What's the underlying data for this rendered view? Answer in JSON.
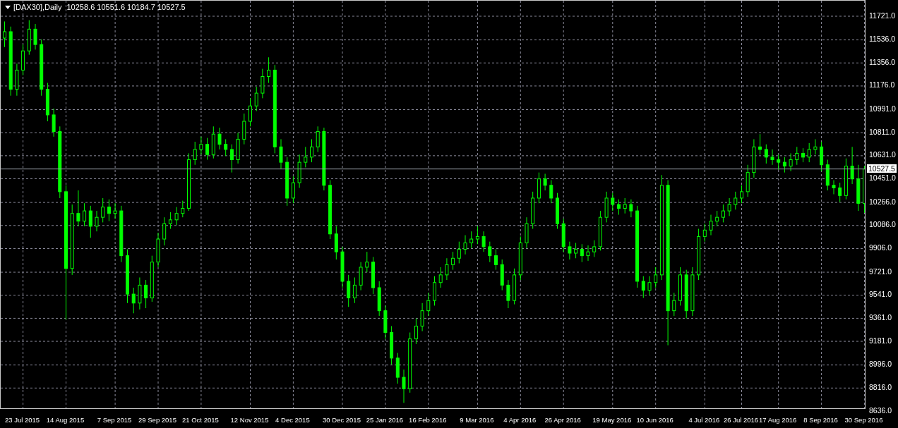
{
  "header": {
    "symbol": "[DAX30],Daily",
    "ohlc": "10258.6 10551.6 10184.7 10527.5"
  },
  "current_price": "10527.5",
  "chart_data": {
    "type": "candlestick",
    "categories": [
      null,
      null,
      null,
      "23 Jul 2015",
      null,
      null,
      null,
      null,
      null,
      null,
      "14 Aug 2015",
      null,
      null,
      null,
      null,
      null,
      null,
      null,
      "7 Sep 2015",
      null,
      null,
      null,
      null,
      null,
      null,
      "29 Sep 2015",
      null,
      null,
      null,
      null,
      null,
      null,
      "21 Oct 2015",
      null,
      null,
      null,
      null,
      null,
      null,
      null,
      "12 Nov 2015",
      null,
      null,
      null,
      null,
      null,
      null,
      "4 Dec 2015",
      null,
      null,
      null,
      null,
      null,
      null,
      null,
      "30 Dec 2015",
      null,
      null,
      null,
      null,
      null,
      null,
      "25 Jan 2016",
      null,
      null,
      null,
      null,
      null,
      null,
      "16 Feb 2016",
      null,
      null,
      null,
      null,
      null,
      null,
      null,
      "9 Mar 2016",
      null,
      null,
      null,
      null,
      null,
      null,
      "4 Apr 2016",
      null,
      null,
      null,
      null,
      null,
      null,
      "26 Apr 2016",
      null,
      null,
      null,
      null,
      null,
      null,
      null,
      "19 May 2016",
      null,
      null,
      null,
      null,
      null,
      null,
      "10 Jun 2016",
      null,
      null,
      null,
      null,
      null,
      null,
      null,
      "4 Jul 2016",
      null,
      null,
      null,
      null,
      null,
      "26 Jul 2016",
      null,
      null,
      null,
      null,
      null,
      "17 Aug 2016",
      null,
      null,
      null,
      null,
      null,
      null,
      "8 Sep 2016",
      null,
      null,
      null,
      null,
      null,
      null,
      "30 Sep 2016"
    ],
    "ohlc": [
      [
        11550,
        11680,
        11480,
        11600
      ],
      [
        11600,
        11640,
        11100,
        11150
      ],
      [
        11150,
        11350,
        11100,
        11300
      ],
      [
        11300,
        11500,
        11260,
        11450
      ],
      [
        11450,
        11690,
        11420,
        11620
      ],
      [
        11620,
        11660,
        11460,
        11500
      ],
      [
        11500,
        11540,
        11100,
        11150
      ],
      [
        11150,
        11200,
        10900,
        10950
      ],
      [
        10950,
        11000,
        10780,
        10820
      ],
      [
        10820,
        10860,
        10300,
        10350
      ],
      [
        10350,
        10400,
        9350,
        9750
      ],
      [
        9750,
        10250,
        9700,
        10180
      ],
      [
        10180,
        10360,
        10080,
        10120
      ],
      [
        10120,
        10260,
        10080,
        10200
      ],
      [
        10200,
        10240,
        9990,
        10080
      ],
      [
        10080,
        10200,
        10040,
        10150
      ],
      [
        10150,
        10300,
        10110,
        10230
      ],
      [
        10230,
        10290,
        10120,
        10180
      ],
      [
        10180,
        10260,
        10140,
        10200
      ],
      [
        10200,
        10240,
        9800,
        9850
      ],
      [
        9850,
        9900,
        9480,
        9550
      ],
      [
        9550,
        9600,
        9400,
        9480
      ],
      [
        9480,
        9680,
        9430,
        9620
      ],
      [
        9620,
        9660,
        9440,
        9520
      ],
      [
        9520,
        9850,
        9490,
        9800
      ],
      [
        9800,
        10030,
        9760,
        9980
      ],
      [
        9980,
        10150,
        9930,
        10100
      ],
      [
        10100,
        10190,
        10060,
        10130
      ],
      [
        10130,
        10230,
        10090,
        10180
      ],
      [
        10180,
        10280,
        10150,
        10220
      ],
      [
        10220,
        10650,
        10200,
        10600
      ],
      [
        10600,
        10740,
        10560,
        10680
      ],
      [
        10680,
        10780,
        10640,
        10720
      ],
      [
        10720,
        10770,
        10600,
        10640
      ],
      [
        10640,
        10860,
        10610,
        10800
      ],
      [
        10800,
        10850,
        10680,
        10720
      ],
      [
        10720,
        10760,
        10630,
        10680
      ],
      [
        10680,
        10720,
        10500,
        10600
      ],
      [
        10600,
        10810,
        10570,
        10760
      ],
      [
        10760,
        10960,
        10720,
        10900
      ],
      [
        10900,
        11080,
        10860,
        11020
      ],
      [
        11020,
        11170,
        10980,
        11120
      ],
      [
        11120,
        11310,
        11080,
        11250
      ],
      [
        11250,
        11400,
        11200,
        11300
      ],
      [
        11300,
        11340,
        10650,
        10700
      ],
      [
        10700,
        10760,
        10530,
        10580
      ],
      [
        10580,
        10620,
        10240,
        10300
      ],
      [
        10300,
        10470,
        10260,
        10420
      ],
      [
        10420,
        10640,
        10380,
        10580
      ],
      [
        10580,
        10700,
        10540,
        10620
      ],
      [
        10620,
        10760,
        10580,
        10700
      ],
      [
        10700,
        10860,
        10660,
        10820
      ],
      [
        10820,
        10850,
        10360,
        10400
      ],
      [
        10400,
        10440,
        9980,
        10020
      ],
      [
        10020,
        10080,
        9820,
        9880
      ],
      [
        9880,
        9920,
        9600,
        9650
      ],
      [
        9650,
        9700,
        9450,
        9520
      ],
      [
        9520,
        9680,
        9480,
        9620
      ],
      [
        9620,
        9800,
        9580,
        9760
      ],
      [
        9760,
        9880,
        9720,
        9800
      ],
      [
        9800,
        9840,
        9550,
        9600
      ],
      [
        9600,
        9650,
        9380,
        9420
      ],
      [
        9420,
        9460,
        9200,
        9250
      ],
      [
        9250,
        9300,
        9000,
        9050
      ],
      [
        9050,
        9090,
        8850,
        8900
      ],
      [
        8900,
        8960,
        8700,
        8810
      ],
      [
        8810,
        9250,
        8780,
        9200
      ],
      [
        9200,
        9360,
        9160,
        9300
      ],
      [
        9300,
        9480,
        9260,
        9420
      ],
      [
        9420,
        9560,
        9380,
        9500
      ],
      [
        9500,
        9690,
        9460,
        9640
      ],
      [
        9640,
        9760,
        9600,
        9700
      ],
      [
        9700,
        9830,
        9660,
        9780
      ],
      [
        9780,
        9880,
        9740,
        9830
      ],
      [
        9830,
        9960,
        9790,
        9900
      ],
      [
        9900,
        10010,
        9860,
        9950
      ],
      [
        9950,
        10040,
        9910,
        9980
      ],
      [
        9980,
        10080,
        9940,
        10000
      ],
      [
        10000,
        10040,
        9880,
        9920
      ],
      [
        9920,
        9960,
        9800,
        9850
      ],
      [
        9850,
        9900,
        9740,
        9780
      ],
      [
        9780,
        9820,
        9580,
        9620
      ],
      [
        9620,
        9660,
        9440,
        9500
      ],
      [
        9500,
        9750,
        9470,
        9700
      ],
      [
        9700,
        10000,
        9660,
        9950
      ],
      [
        9950,
        10150,
        9910,
        10100
      ],
      [
        10100,
        10350,
        10060,
        10300
      ],
      [
        10300,
        10500,
        10260,
        10450
      ],
      [
        10450,
        10490,
        10360,
        10400
      ],
      [
        10400,
        10440,
        10260,
        10300
      ],
      [
        10300,
        10340,
        10060,
        10100
      ],
      [
        10100,
        10140,
        9880,
        9920
      ],
      [
        9920,
        9960,
        9820,
        9870
      ],
      [
        9870,
        9950,
        9830,
        9900
      ],
      [
        9900,
        9940,
        9800,
        9850
      ],
      [
        9850,
        9930,
        9810,
        9880
      ],
      [
        9880,
        9970,
        9840,
        9920
      ],
      [
        9920,
        10200,
        9890,
        10150
      ],
      [
        10150,
        10350,
        10110,
        10300
      ],
      [
        10300,
        10340,
        10200,
        10250
      ],
      [
        10250,
        10290,
        10170,
        10220
      ],
      [
        10220,
        10300,
        10180,
        10250
      ],
      [
        10250,
        10290,
        10150,
        10200
      ],
      [
        10200,
        10240,
        9600,
        9650
      ],
      [
        9650,
        9690,
        9520,
        9580
      ],
      [
        9580,
        9690,
        9540,
        9640
      ],
      [
        9640,
        9760,
        9600,
        9700
      ],
      [
        9700,
        10480,
        9660,
        10400
      ],
      [
        10400,
        10440,
        9150,
        9420
      ],
      [
        9420,
        9560,
        9380,
        9500
      ],
      [
        9500,
        9760,
        9460,
        9700
      ],
      [
        9700,
        9740,
        9360,
        9420
      ],
      [
        9420,
        9760,
        9380,
        9700
      ],
      [
        9700,
        10060,
        9660,
        10000
      ],
      [
        10000,
        10100,
        9960,
        10050
      ],
      [
        10050,
        10170,
        10010,
        10120
      ],
      [
        10120,
        10200,
        10080,
        10150
      ],
      [
        10150,
        10250,
        10110,
        10200
      ],
      [
        10200,
        10300,
        10160,
        10250
      ],
      [
        10250,
        10350,
        10210,
        10300
      ],
      [
        10300,
        10400,
        10260,
        10350
      ],
      [
        10350,
        10560,
        10310,
        10500
      ],
      [
        10500,
        10760,
        10460,
        10700
      ],
      [
        10700,
        10800,
        10640,
        10680
      ],
      [
        10680,
        10720,
        10570,
        10620
      ],
      [
        10620,
        10680,
        10560,
        10600
      ],
      [
        10600,
        10640,
        10520,
        10580
      ],
      [
        10580,
        10620,
        10500,
        10550
      ],
      [
        10550,
        10650,
        10510,
        10600
      ],
      [
        10600,
        10700,
        10560,
        10650
      ],
      [
        10650,
        10690,
        10580,
        10620
      ],
      [
        10620,
        10730,
        10580,
        10680
      ],
      [
        10680,
        10760,
        10640,
        10700
      ],
      [
        10700,
        10740,
        10510,
        10560
      ],
      [
        10560,
        10600,
        10360,
        10400
      ],
      [
        10400,
        10440,
        10330,
        10380
      ],
      [
        10380,
        10420,
        10270,
        10320
      ],
      [
        10320,
        10610,
        10290,
        10550
      ],
      [
        10550,
        10700,
        10410,
        10450
      ],
      [
        10450,
        10560,
        10200,
        10259
      ],
      [
        10258.6,
        10551.6,
        10184.7,
        10527.5
      ]
    ],
    "ylim": [
      8636,
      11721
    ],
    "yticks": [
      {
        "value": 11721,
        "label": "11721.0"
      },
      {
        "value": 11536,
        "label": "11536.0"
      },
      {
        "value": 11356,
        "label": "11356.0"
      },
      {
        "value": 11176,
        "label": "11176.0"
      },
      {
        "value": 10991,
        "label": "10991.0"
      },
      {
        "value": 10811,
        "label": "10811.0"
      },
      {
        "value": 10631,
        "label": "10631.0"
      },
      {
        "value": 10451,
        "label": "10451.0"
      },
      {
        "value": 10266,
        "label": "10266.0"
      },
      {
        "value": 10086,
        "label": "10086.0"
      },
      {
        "value": 9906,
        "label": "9906.0"
      },
      {
        "value": 9721,
        "label": "9721.0"
      },
      {
        "value": 9541,
        "label": "9541.0"
      },
      {
        "value": 9361,
        "label": "9361.0"
      },
      {
        "value": 9181,
        "label": "9181.0"
      },
      {
        "value": 8996,
        "label": "8996.0"
      },
      {
        "value": 8816,
        "label": "8816.0"
      },
      {
        "value": 8636,
        "label": "8636.0"
      }
    ],
    "grid": true,
    "ref_lines": [
      {
        "axis": "y",
        "value": 10527.5
      }
    ]
  }
}
